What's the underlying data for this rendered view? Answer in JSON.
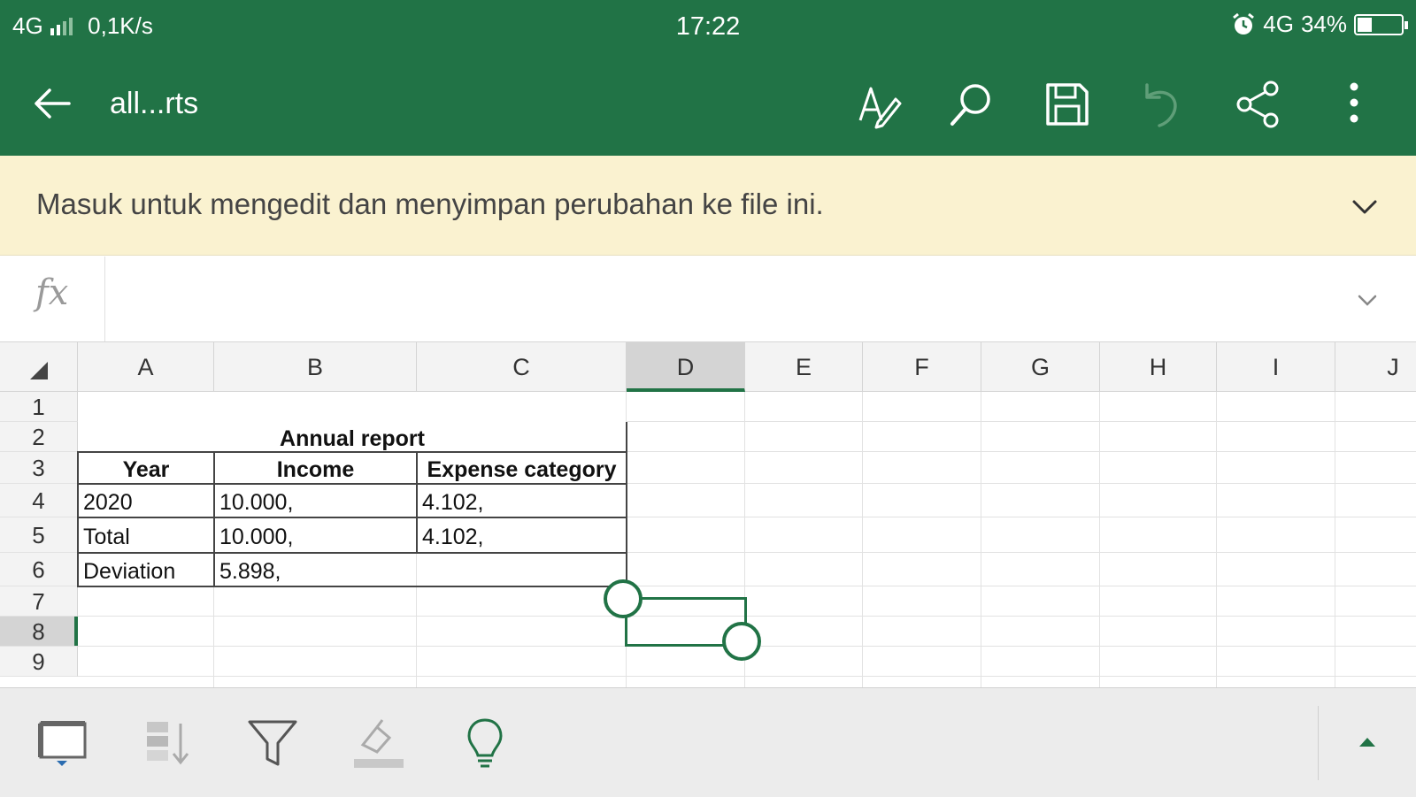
{
  "status_bar": {
    "signal": "4G",
    "speed": "0,1K/s",
    "time": "17:22",
    "network": "4G",
    "battery": "34%",
    "battery_level": 0.34
  },
  "app_bar": {
    "title": "all...rts",
    "icons": [
      "back-arrow-icon",
      "draw-pen-icon",
      "search-icon",
      "save-icon",
      "undo-icon",
      "share-icon",
      "more-icon"
    ]
  },
  "banner": {
    "message": "Masuk untuk mengedit dan menyimpan perubahan ke file ini."
  },
  "formula_bar": {
    "fx_label": "fx",
    "value": ""
  },
  "sheet": {
    "columns": [
      "A",
      "B",
      "C",
      "D",
      "E",
      "F",
      "G",
      "H",
      "I",
      "J"
    ],
    "rows": [
      "1",
      "2",
      "3",
      "4",
      "5",
      "6",
      "7",
      "8",
      "9"
    ],
    "selected_column": "D",
    "selected_row": "8",
    "title": "Annual report",
    "headers": [
      "Year",
      "Income",
      "Expense category"
    ],
    "data": [
      [
        "2020",
        "10.000,",
        "4.102,"
      ],
      [
        "Total",
        "10.000,",
        "4.102,"
      ],
      [
        "Deviation",
        "5.898,",
        ""
      ]
    ]
  },
  "bottom_toolbar": {
    "icons": [
      "freeze-panes-icon",
      "sort-icon",
      "filter-icon",
      "clear-format-icon",
      "lightbulb-icon",
      "expand-up-icon"
    ]
  }
}
